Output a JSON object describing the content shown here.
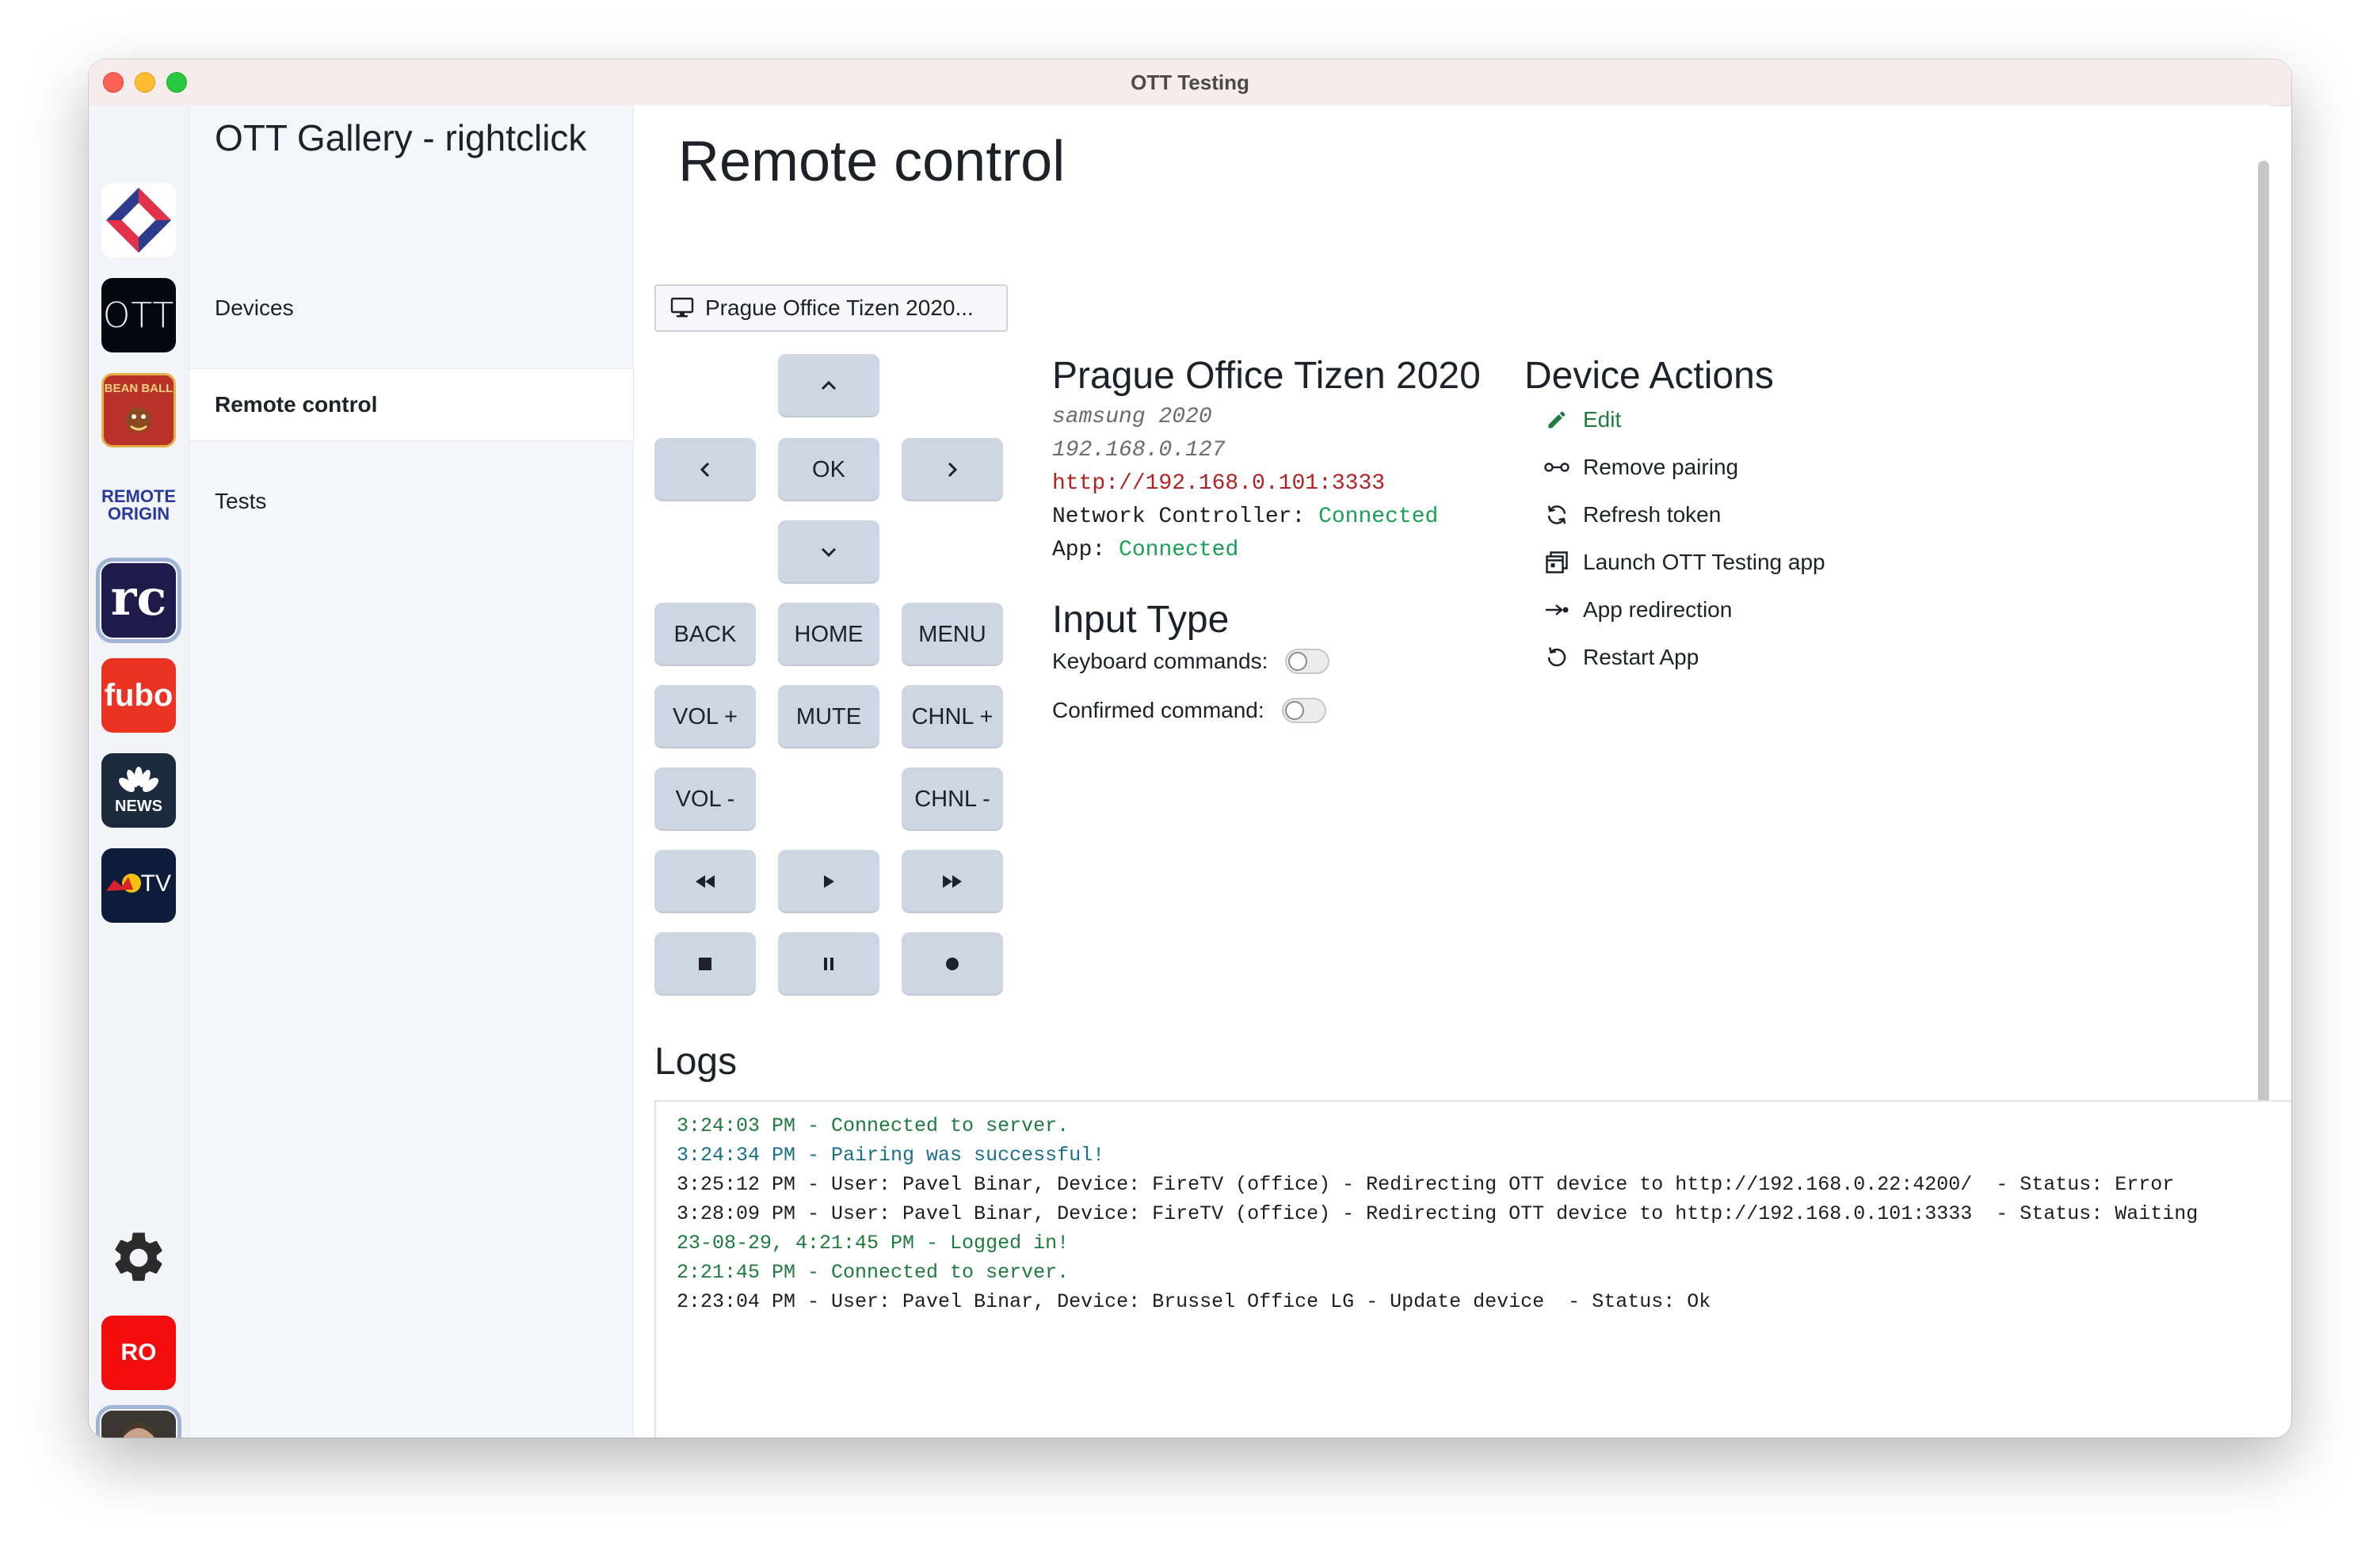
{
  "window": {
    "title": "OTT Testing"
  },
  "rail": {
    "apps": [
      {
        "name": "rightclick",
        "icon": "rightclick-logo-icon"
      },
      {
        "name": "OTT",
        "label": "OTT",
        "icon": "ott-logo-icon"
      },
      {
        "name": "Bean Ball",
        "label": "BEAN BALL",
        "icon": "bean-ball-logo-icon"
      },
      {
        "name": "Remote Origin",
        "label_top": "REMOTE",
        "label_bottom": "ORIGIN",
        "icon": "remote-origin-logo-icon"
      },
      {
        "name": "rc",
        "label": "rc",
        "icon": "rc-logo-icon",
        "selected": true
      },
      {
        "name": "fubo",
        "label": "fubo",
        "icon": "fubo-logo-icon"
      },
      {
        "name": "NBC News",
        "label": "NEWS",
        "icon": "nbc-news-logo-icon"
      },
      {
        "name": "Red Bull TV",
        "label": "TV",
        "icon": "redbull-tv-logo-icon"
      }
    ],
    "settings_icon": "gear-icon",
    "user_initials": "RO",
    "avatar_icon": "user-avatar-icon"
  },
  "nav": {
    "title": "OTT Gallery - rightclick",
    "items": [
      {
        "label": "Devices"
      },
      {
        "label": "Remote control",
        "active": true
      },
      {
        "label": "Tests"
      }
    ]
  },
  "main": {
    "title": "Remote control",
    "device_select": {
      "value": "Prague Office Tizen 2020...",
      "icon": "monitor-icon"
    }
  },
  "remote": {
    "ok": "OK",
    "back": "BACK",
    "home": "HOME",
    "menu": "MENU",
    "vol_up": "VOL +",
    "mute": "MUTE",
    "chnl_up": "CHNL +",
    "vol_down": "VOL -",
    "chnl_down": "CHNL -"
  },
  "device": {
    "name": "Prague Office Tizen 2020",
    "model": "samsung 2020",
    "ip": "192.168.0.127",
    "url": "http://192.168.0.101:3333",
    "network_label": "Network Controller:",
    "network_status": "Connected",
    "app_label": "App:",
    "app_status": "Connected"
  },
  "input_type": {
    "title": "Input Type",
    "keyboard_label": "Keyboard commands:",
    "keyboard_on": false,
    "confirmed_label": "Confirmed command:",
    "confirmed_on": false
  },
  "actions": {
    "title": "Device Actions",
    "items": [
      {
        "label": "Edit",
        "icon": "pencil-icon"
      },
      {
        "label": "Remove pairing",
        "icon": "unlink-icon"
      },
      {
        "label": "Refresh token",
        "icon": "refresh-icon"
      },
      {
        "label": "Launch OTT Testing app",
        "icon": "launch-app-icon"
      },
      {
        "label": "App redirection",
        "icon": "redirect-icon"
      },
      {
        "label": "Restart App",
        "icon": "restart-icon"
      }
    ]
  },
  "logs": {
    "title": "Logs",
    "lines": [
      {
        "text": "3:24:03 PM - Connected to server.",
        "color": "#1f7a3d"
      },
      {
        "text": "3:24:34 PM - Pairing was successful!",
        "color": "#1a6f8a"
      },
      {
        "text": "3:25:12 PM - User: Pavel Binar, Device: FireTV (office) - Redirecting OTT device to http://192.168.0.22:4200/  - Status: Error",
        "color": "#1d1d1f"
      },
      {
        "text": "3:28:09 PM - User: Pavel Binar, Device: FireTV (office) - Redirecting OTT device to http://192.168.0.101:3333  - Status: Waiting",
        "color": "#1d1d1f"
      },
      {
        "text": "23-08-29, 4:21:45 PM - Logged in!",
        "color": "#1f7a3d"
      },
      {
        "text": "2:21:45 PM - Connected to server.",
        "color": "#1f7a3d"
      },
      {
        "text": "2:23:04 PM - User: Pavel Binar, Device: Brussel Office LG - Update device  - Status: Ok",
        "color": "#1d1d1f"
      }
    ]
  }
}
